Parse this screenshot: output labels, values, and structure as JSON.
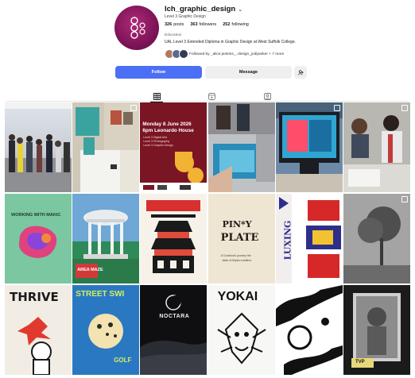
{
  "profile": {
    "username": "lch_graphic_design",
    "category": "Level 3 Graphic Design",
    "stats": {
      "posts_count": "326",
      "posts_label": "posts",
      "followers_count": "363",
      "followers_label": "followers",
      "following_count": "252",
      "following_label": "following"
    },
    "education_label": "Education",
    "bio": "UAL Level 3 Extended Diploma in Graphic Design at West Suffolk College.",
    "followed_by": "Followed by _alice.jenkins_, design_jodiparker + 7 more"
  },
  "actions": {
    "follow": "Follow",
    "message": "Message"
  },
  "tabs": [
    {
      "icon": "grid-icon",
      "active": true
    },
    {
      "icon": "reels-icon",
      "active": false
    },
    {
      "icon": "tagged-icon",
      "active": false
    }
  ],
  "posts": {
    "p3": {
      "line1": "Monday 8 June 2026",
      "line2": "6pm Leonardo House",
      "line3": "Level 3 Digital Arts",
      "line4": "Level 3 Photography",
      "line5": "Level 3 Graphic Design"
    },
    "p7": {
      "text": "WORKING WITH MAKIC"
    },
    "p8": {
      "text": "AREA MAZE"
    },
    "p10": {
      "line1": "PIN*Y",
      "line2": "PLATE",
      "line3": "A Cookbook journey the",
      "line4": "taste of filipino tradition"
    },
    "p11": {
      "text": "LUXING"
    },
    "p13": {
      "text": "THRIVE"
    },
    "p14": {
      "line1": "STREET SWI",
      "line2": "GOLF"
    },
    "p15": {
      "text": "NOCTARA"
    },
    "p16": {
      "text": "YOKAI"
    },
    "p18": {
      "text": "TVP"
    }
  },
  "colors": {
    "accent": "#4b6ff5",
    "button_secondary": "#efefef",
    "avatar": "#8a1a63"
  }
}
